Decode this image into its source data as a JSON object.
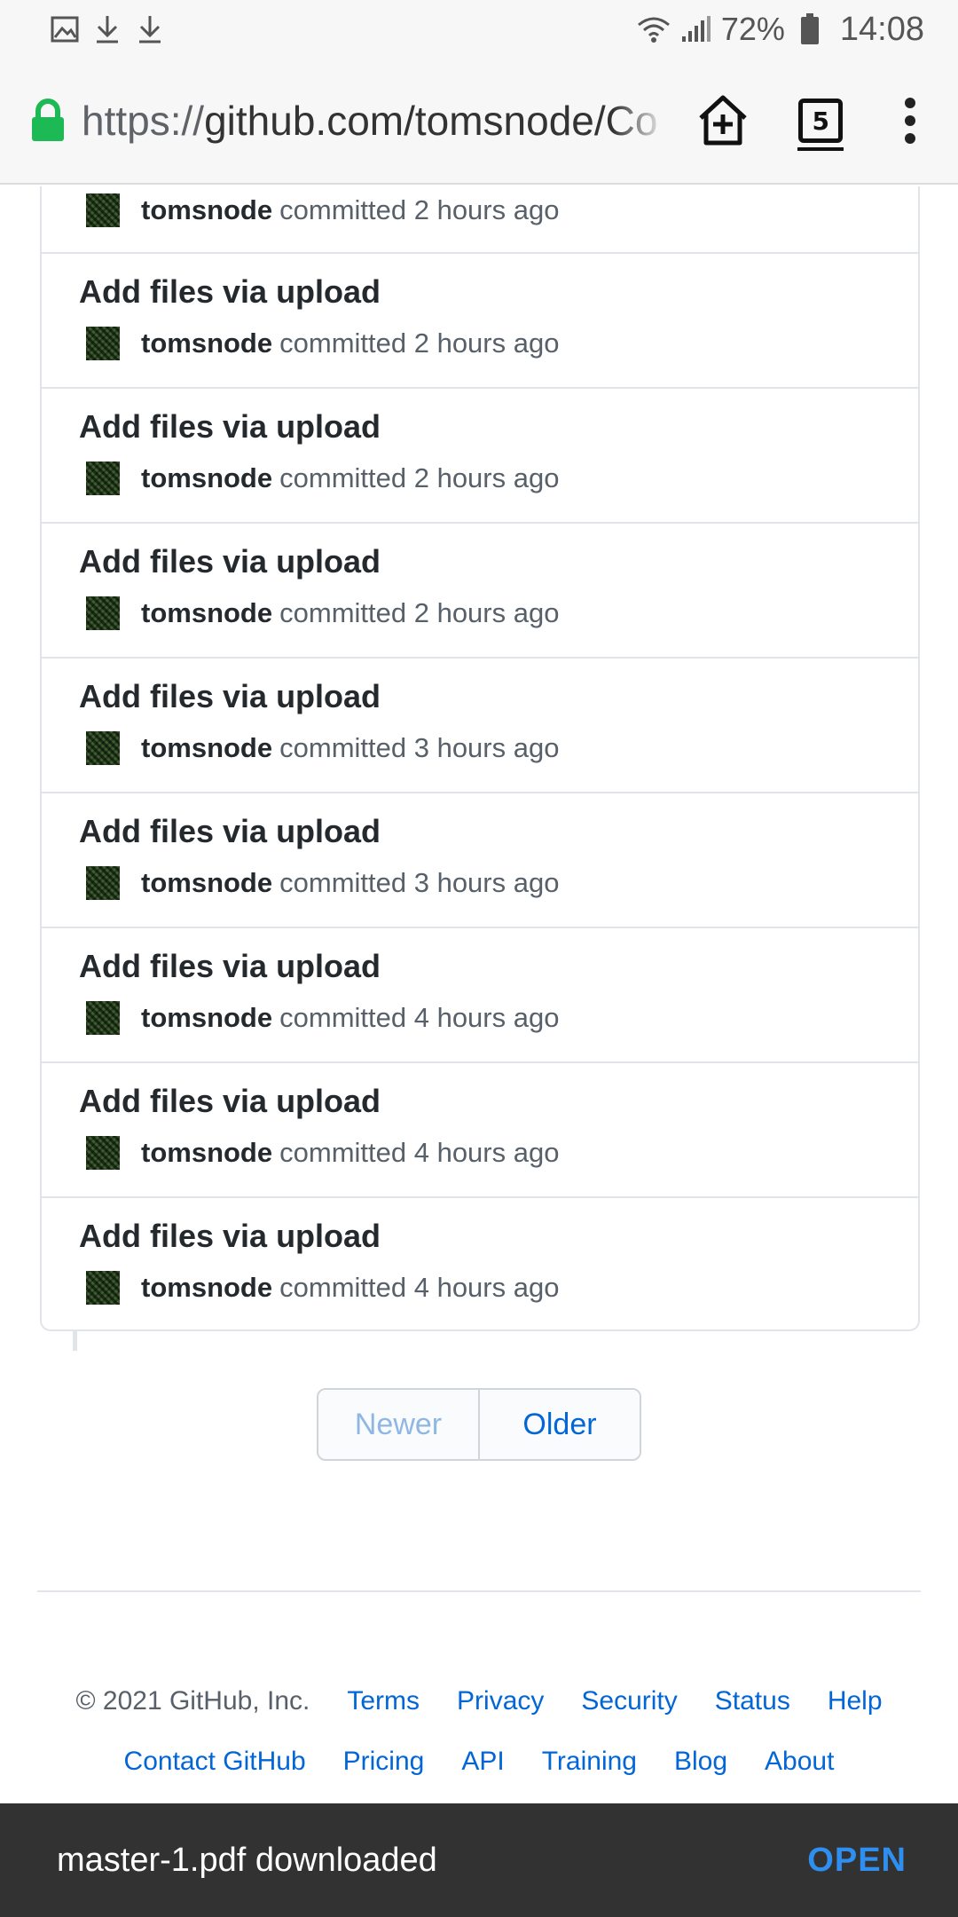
{
  "status_bar": {
    "left_icons": [
      "image-icon",
      "download-icon",
      "download-icon"
    ],
    "battery_percent": "72%",
    "time": "14:08"
  },
  "browser": {
    "url_scheme": "https://",
    "url_rest": "github.com/tomsnode/Co",
    "tab_count": "5"
  },
  "commits": [
    {
      "title": "",
      "author": "tomsnode",
      "when": "committed 2 hours ago"
    },
    {
      "title": "Add files via upload",
      "author": "tomsnode",
      "when": "committed 2 hours ago"
    },
    {
      "title": "Add files via upload",
      "author": "tomsnode",
      "when": "committed 2 hours ago"
    },
    {
      "title": "Add files via upload",
      "author": "tomsnode",
      "when": "committed 2 hours ago"
    },
    {
      "title": "Add files via upload",
      "author": "tomsnode",
      "when": "committed 3 hours ago"
    },
    {
      "title": "Add files via upload",
      "author": "tomsnode",
      "when": "committed 3 hours ago"
    },
    {
      "title": "Add files via upload",
      "author": "tomsnode",
      "when": "committed 4 hours ago"
    },
    {
      "title": "Add files via upload",
      "author": "tomsnode",
      "when": "committed 4 hours ago"
    },
    {
      "title": "Add files via upload",
      "author": "tomsnode",
      "when": "committed 4 hours ago"
    }
  ],
  "pagination": {
    "newer": "Newer",
    "older": "Older"
  },
  "footer": {
    "copyright": "© 2021 GitHub, Inc.",
    "links_row1": [
      "Terms",
      "Privacy",
      "Security",
      "Status",
      "Help"
    ],
    "links_row2": [
      "Contact GitHub",
      "Pricing",
      "API",
      "Training",
      "Blog",
      "About"
    ]
  },
  "snackbar": {
    "message": "master-1.pdf downloaded",
    "action": "OPEN"
  },
  "colors": {
    "link": "#0366d6",
    "lock": "#1db954",
    "snackbar_action": "#2f8ff0"
  }
}
